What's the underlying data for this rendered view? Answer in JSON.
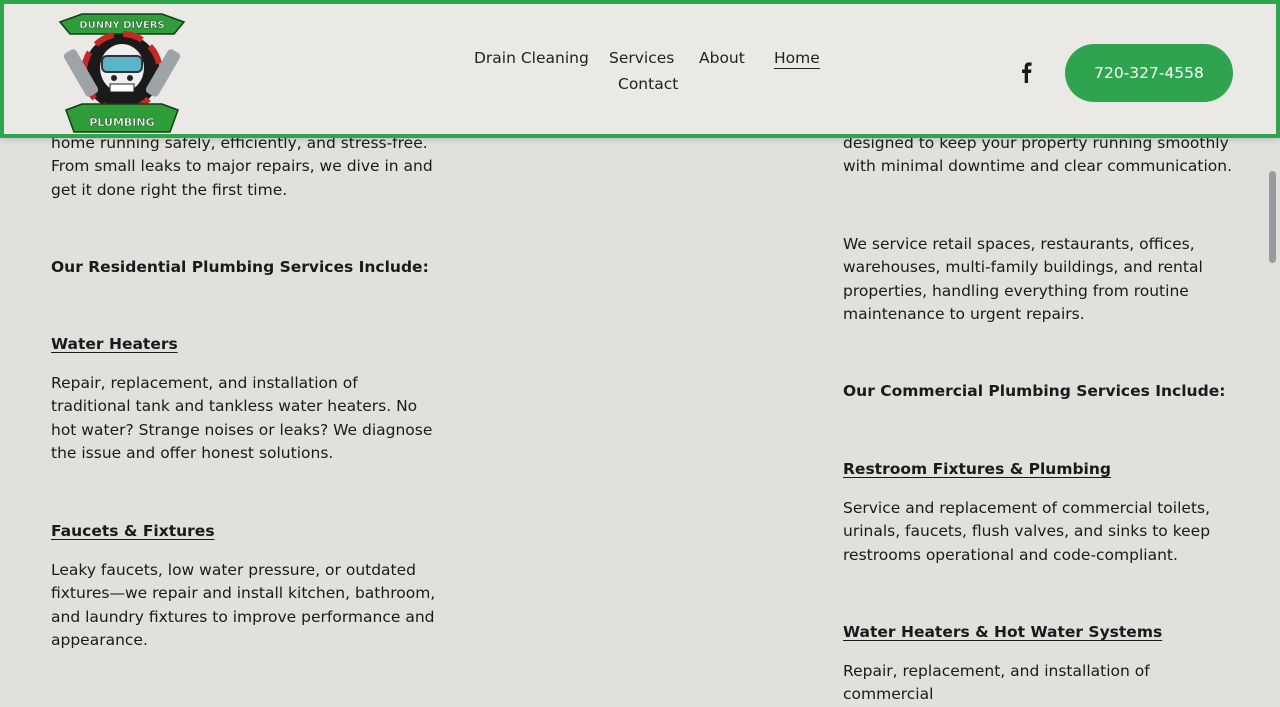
{
  "header": {
    "logo": {
      "top_text": "DUNNY DIVERS",
      "bottom_text": "PLUMBING"
    },
    "nav": [
      {
        "label": "Drain Cleaning"
      },
      {
        "label": "Services"
      },
      {
        "label": "About"
      },
      {
        "label": "Home"
      },
      {
        "label": "Contact"
      }
    ],
    "social_icon": "facebook-icon",
    "phone": "720-327-4558"
  },
  "left": {
    "intro": "home running safely, efficiently, and stress-free. From small leaks to major repairs, we dive in and get it done right the first time.",
    "heading": "Our Residential Plumbing Services Include:",
    "items": [
      {
        "title": "Water Heaters",
        "text": "Repair, replacement, and installation of traditional tank and tankless water heaters. No hot water? Strange noises or leaks? We diagnose the issue and offer honest solutions."
      },
      {
        "title": "Faucets & Fixtures",
        "text": "Leaky faucets, low water pressure, or outdated fixtures—we repair and install kitchen, bathroom, and laundry fixtures to improve performance and appearance."
      }
    ]
  },
  "right": {
    "intro": "designed to keep your property running smoothly with minimal downtime and clear communication.",
    "para2": "We service retail spaces, restaurants, offices, warehouses, multi-family buildings, and rental properties, handling everything from routine maintenance to urgent repairs.",
    "heading": "Our Commercial Plumbing Services Include:",
    "items": [
      {
        "title": "Restroom Fixtures & Plumbing",
        "text": "Service and replacement of commercial toilets, urinals, faucets, flush valves, and sinks to keep restrooms operational and code-compliant."
      },
      {
        "title": "Water Heaters & Hot Water Systems",
        "text": "Repair, replacement, and installation of commercial"
      }
    ]
  },
  "colors": {
    "brand_green": "#2ea44f",
    "background": "#e2e0dd",
    "text": "#1a1a1a"
  }
}
